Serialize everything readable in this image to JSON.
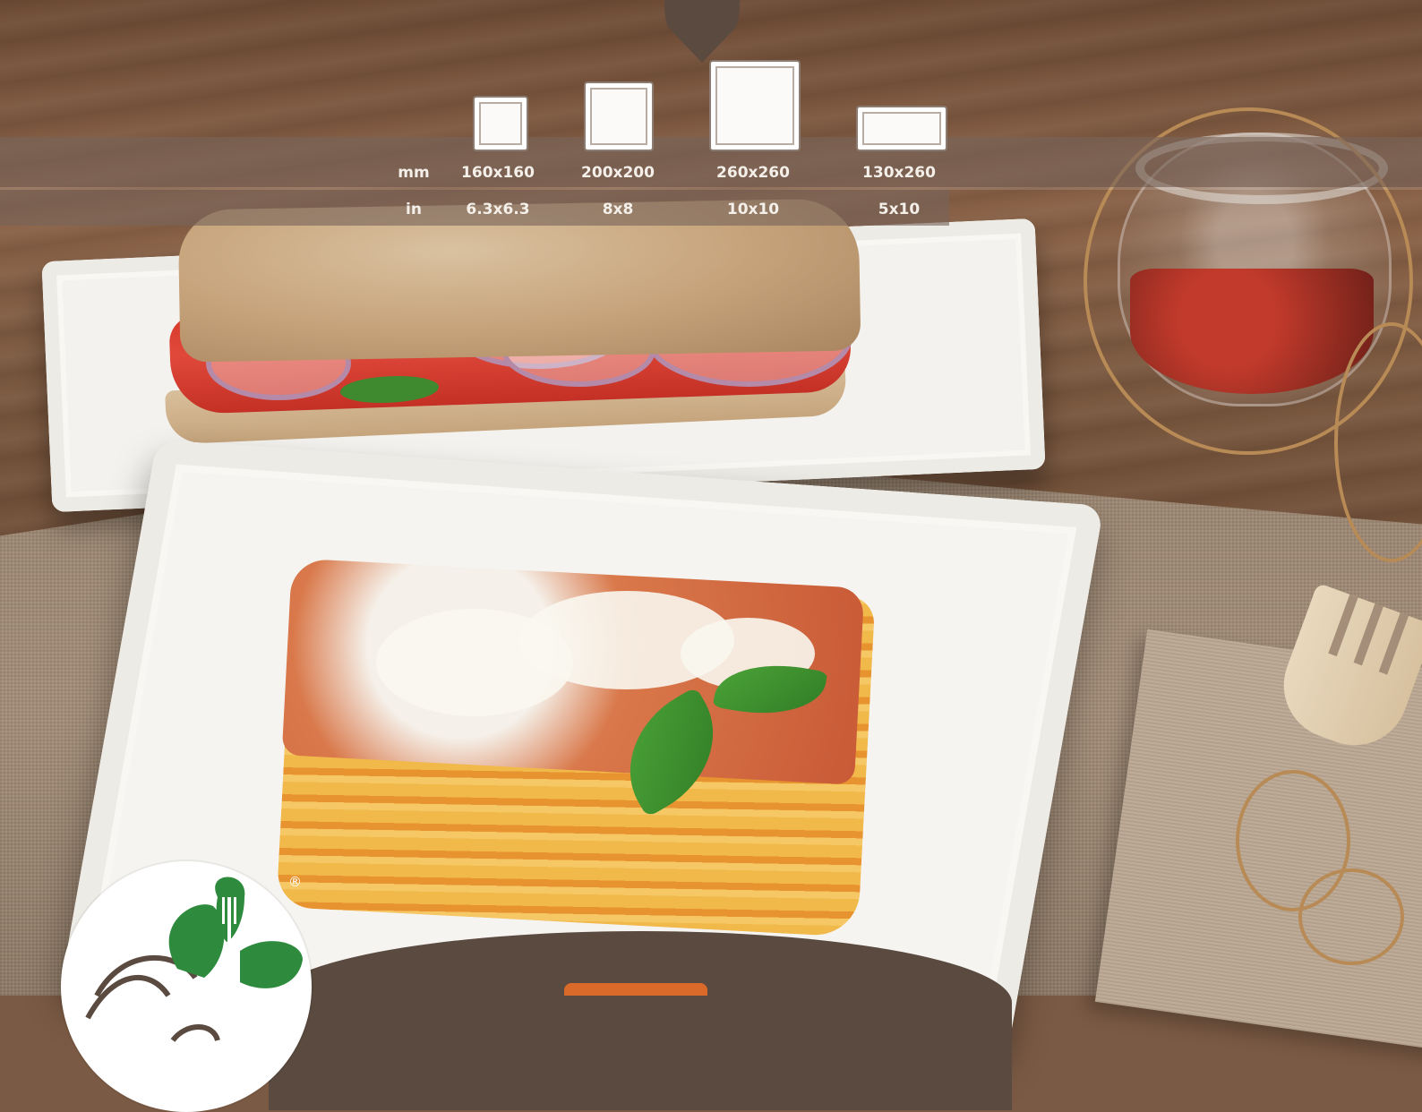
{
  "size_chart": {
    "mm_label": "mm",
    "in_label": "in",
    "sizes": [
      {
        "mm": "160x160",
        "in": "6.3x6.3"
      },
      {
        "mm": "200x200",
        "in": "8x8"
      },
      {
        "mm": "260x260",
        "in": "10x10"
      },
      {
        "mm": "130x260",
        "in": "5x10"
      }
    ]
  },
  "logo": {
    "registered_mark": "®"
  },
  "colors": {
    "brand_brown": "#5a4a40",
    "brand_green": "#2e8b3e",
    "accent_orange": "#d96a2a"
  }
}
